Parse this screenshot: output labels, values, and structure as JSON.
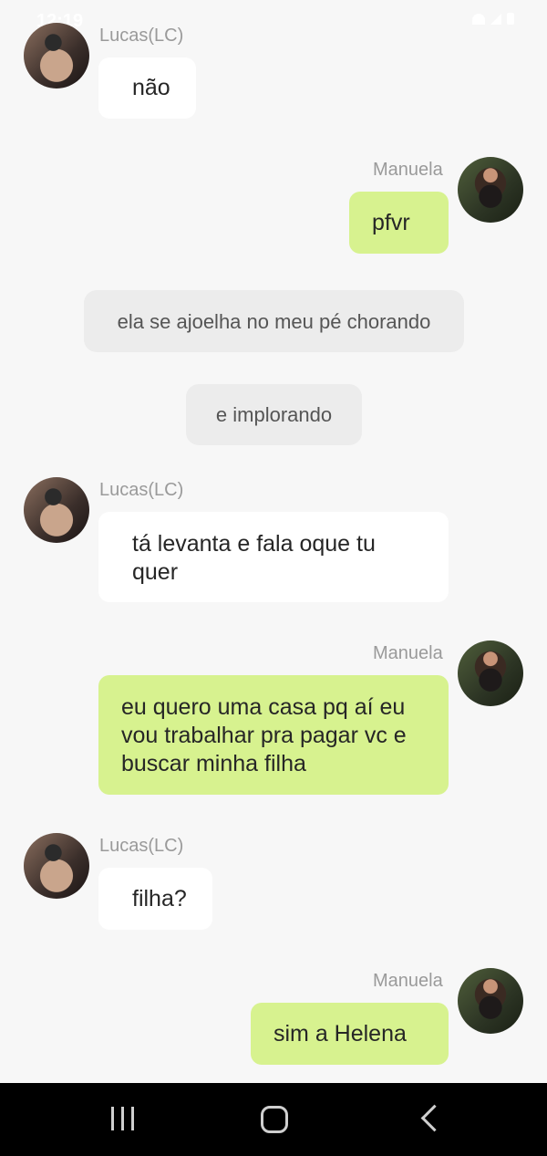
{
  "status": {
    "time": "12:19"
  },
  "participants": {
    "lucas": "Lucas(LC)",
    "manuela": "Manuela"
  },
  "messages": [
    {
      "type": "incoming",
      "sender": "Lucas(LC)",
      "text": "não"
    },
    {
      "type": "outgoing",
      "sender": "Manuela",
      "text": "pfvr"
    },
    {
      "type": "narration",
      "text": "ela se ajoelha no meu pé chorando"
    },
    {
      "type": "narration",
      "text": "e implorando"
    },
    {
      "type": "incoming",
      "sender": "Lucas(LC)",
      "text": "tá levanta e fala oque tu quer"
    },
    {
      "type": "outgoing",
      "sender": "Manuela",
      "text": "eu quero uma casa pq aí eu vou trabalhar pra pagar vc e buscar minha filha"
    },
    {
      "type": "incoming",
      "sender": "Lucas(LC)",
      "text": "filha?"
    },
    {
      "type": "outgoing",
      "sender": "Manuela",
      "text": "sim a Helena"
    }
  ],
  "icons": {
    "recents": "recents-icon",
    "home": "home-icon",
    "back": "back-icon"
  },
  "colors": {
    "background": "#f7f7f7",
    "incoming_bubble": "#ffffff",
    "outgoing_bubble": "#d7f28f",
    "narration_bubble": "#ececec",
    "nav_bar": "#000000"
  }
}
